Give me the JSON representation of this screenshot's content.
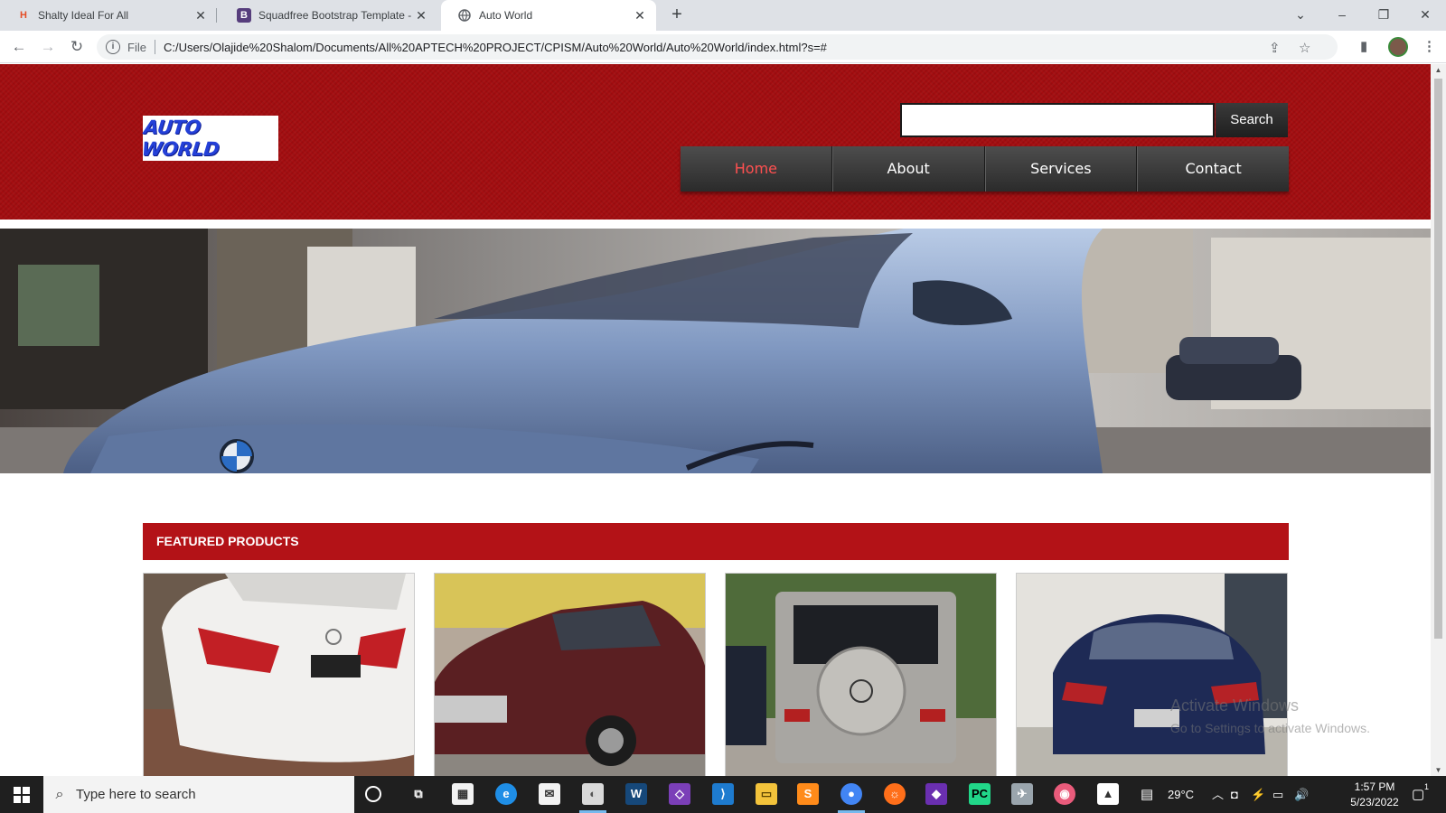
{
  "browser": {
    "tabs": [
      {
        "title": "Shalty Ideal For All",
        "favicon": "H",
        "favicon_color": "#e44d26"
      },
      {
        "title": "Squadfree Bootstrap Template - I",
        "favicon": "B",
        "favicon_color": "#563d7c"
      },
      {
        "title": "Auto World",
        "favicon": "globe",
        "favicon_color": "#5f6368"
      }
    ],
    "file_label": "File",
    "url": "C:/Users/Olajide%20Shalom/Documents/All%20APTECH%20PROJECT/CPISM/Auto%20World/Auto%20World/index.html?s=#",
    "window_controls": [
      "–",
      "❐",
      "✕"
    ]
  },
  "site": {
    "logo_text": "AUTO WORLD",
    "search": {
      "placeholder": "",
      "button_label": "Search"
    },
    "nav": [
      {
        "label": "Home",
        "active": true
      },
      {
        "label": "About",
        "active": false
      },
      {
        "label": "Services",
        "active": false
      },
      {
        "label": "Contact",
        "active": false
      }
    ],
    "featured_title": "FEATURED PRODUCTS",
    "products": [
      {
        "name": "white-lexus"
      },
      {
        "name": "maroon-honda-accord"
      },
      {
        "name": "silver-mercedes-g-wagon"
      },
      {
        "name": "blue-honda-accord"
      }
    ],
    "colors": {
      "header_red": "#a30d10",
      "bar_red": "#b31217",
      "nav_dark": "#2b2b2b",
      "active_nav": "#ff5050"
    }
  },
  "os": {
    "watermark_title": "Activate Windows",
    "watermark_sub": "Go to Settings to activate Windows.",
    "search_placeholder": "Type here to search",
    "temperature": "29°C",
    "time": "1:57 PM",
    "date": "5/23/2022",
    "notification_count": "1"
  }
}
